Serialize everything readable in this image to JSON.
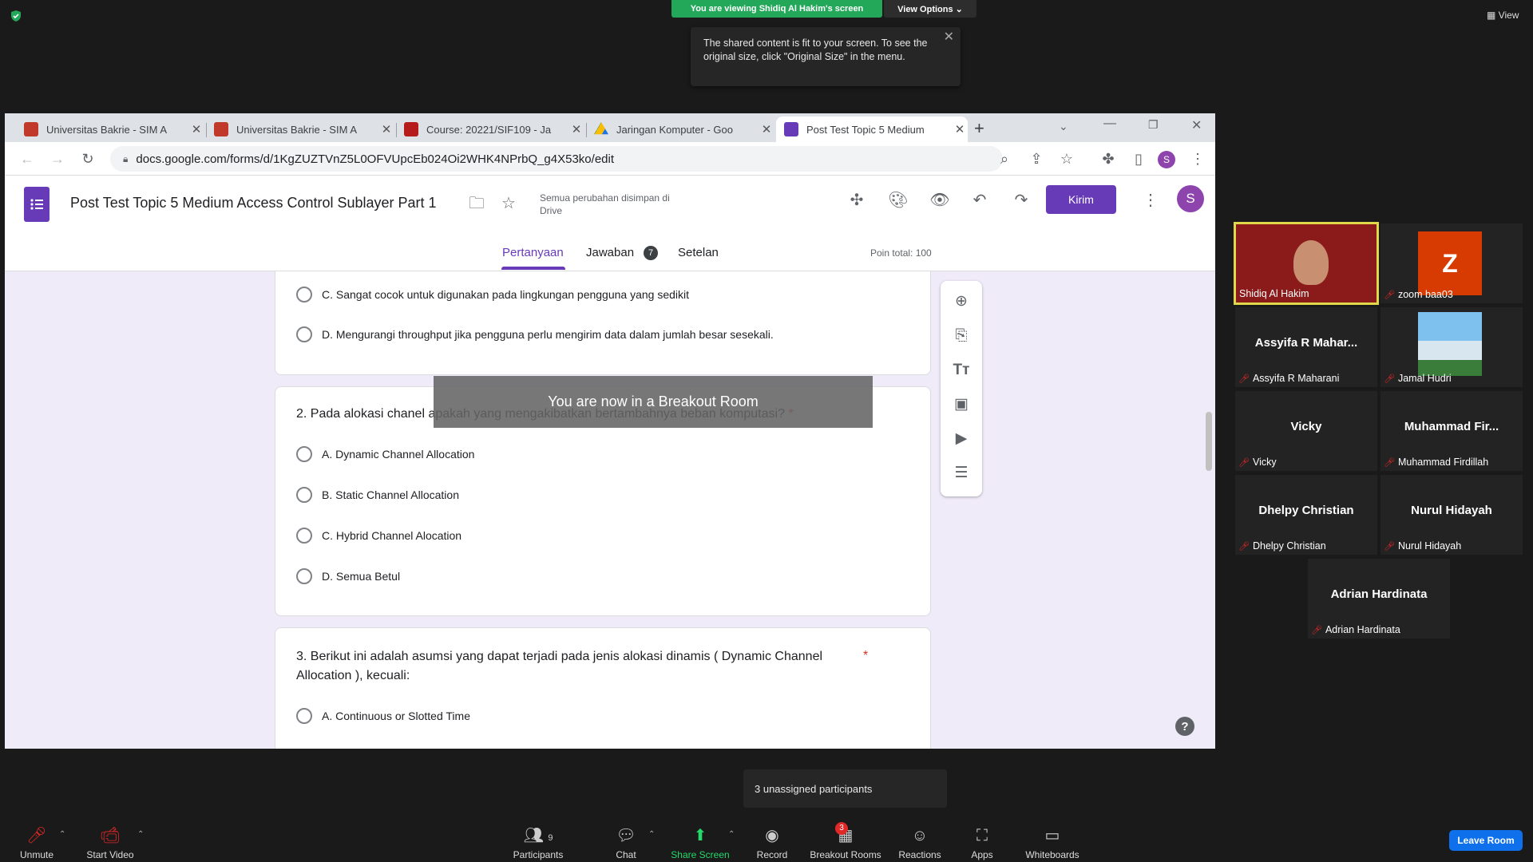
{
  "zoom_top": {
    "viewing_banner": "You are viewing Shidiq Al Hakim's screen",
    "view_options": "View Options ⌄",
    "tooltip": "The shared content is fit to your screen. To see the original size, click \"Original Size\" in the menu.",
    "view_label": "View"
  },
  "browser": {
    "tabs": [
      {
        "title": "Universitas Bakrie - SIM A",
        "favicon_color": "#c0392b"
      },
      {
        "title": "Universitas Bakrie - SIM A",
        "favicon_color": "#c0392b"
      },
      {
        "title": "Course: 20221/SIF109 - Ja",
        "favicon_color": "#b71c1c"
      },
      {
        "title": "Jaringan Komputer - Goo",
        "favicon_color": "#1e8e3e"
      },
      {
        "title": "Post Test Topic 5 Medium",
        "favicon_color": "#673ab7"
      }
    ],
    "url": "docs.google.com/forms/d/1KgZUZTVnZ5L0OFVUpcEb024Oi2WHK4NPrbQ_g4X53ko/edit",
    "profile_initial": "S"
  },
  "form": {
    "title": "Post Test Topic 5 Medium Access Control Sublayer Part 1",
    "saved_status": "Semua perubahan disimpan di Drive",
    "send_label": "Kirim",
    "avatar_initial": "S",
    "tabs": {
      "questions": "Pertanyaan",
      "responses": "Jawaban",
      "responses_count": "7",
      "settings": "Setelan"
    },
    "total_points": "Poin total: 100",
    "q1_options": [
      "C. Sangat cocok untuk digunakan pada lingkungan pengguna yang sedikit",
      "D. Mengurangi throughput jika pengguna perlu mengirim data dalam jumlah besar sesekali."
    ],
    "q2": {
      "text": "2.  Pada alokasi chanel apakah yang mengakibatkan bertambahnya beban komputasi?",
      "required_mark": "*",
      "options": [
        "A. Dynamic Channel Allocation",
        "B. Static Channel Allocation",
        "C. Hybrid Channel Alocation",
        "D. Semua Betul"
      ]
    },
    "q3": {
      "text": "3. Berikut ini adalah asumsi yang dapat terjadi pada jenis alokasi dinamis ( Dynamic Channel Allocation ), kecuali:",
      "required_mark": "*",
      "options": [
        "A. Continuous or Slotted Time"
      ]
    },
    "breakout_toast": "You are now in a Breakout Room",
    "help": "?"
  },
  "participants_gallery": [
    {
      "name": "",
      "label": "Shidiq Al Hakim",
      "muted": false
    },
    {
      "name": "Z",
      "label": "zoom baa03",
      "muted": true
    },
    {
      "name": "Assyifa R Mahar...",
      "label": "Assyifa R Maharani",
      "muted": true
    },
    {
      "name": "",
      "label": "Jamal Hudri",
      "muted": true
    },
    {
      "name": "Vicky",
      "label": "Vicky",
      "muted": true
    },
    {
      "name": "Muhammad Fir...",
      "label": "Muhammad Firdillah",
      "muted": true
    },
    {
      "name": "Dhelpy Christian",
      "label": "Dhelpy Christian",
      "muted": true
    },
    {
      "name": "Nurul Hidayah",
      "label": "Nurul Hidayah",
      "muted": true
    },
    {
      "name": "Adrian Hardinata",
      "label": "Adrian Hardinata",
      "muted": true
    }
  ],
  "bottom_bar": {
    "unassigned": "3 unassigned participants",
    "unmute": "Unmute",
    "start_video": "Start Video",
    "participants": "Participants",
    "participants_count": "9",
    "chat": "Chat",
    "share_screen": "Share Screen",
    "record": "Record",
    "breakout_rooms": "Breakout Rooms",
    "breakout_count": "3",
    "reactions": "Reactions",
    "apps": "Apps",
    "whiteboards": "Whiteboards",
    "leave_room": "Leave Room"
  }
}
